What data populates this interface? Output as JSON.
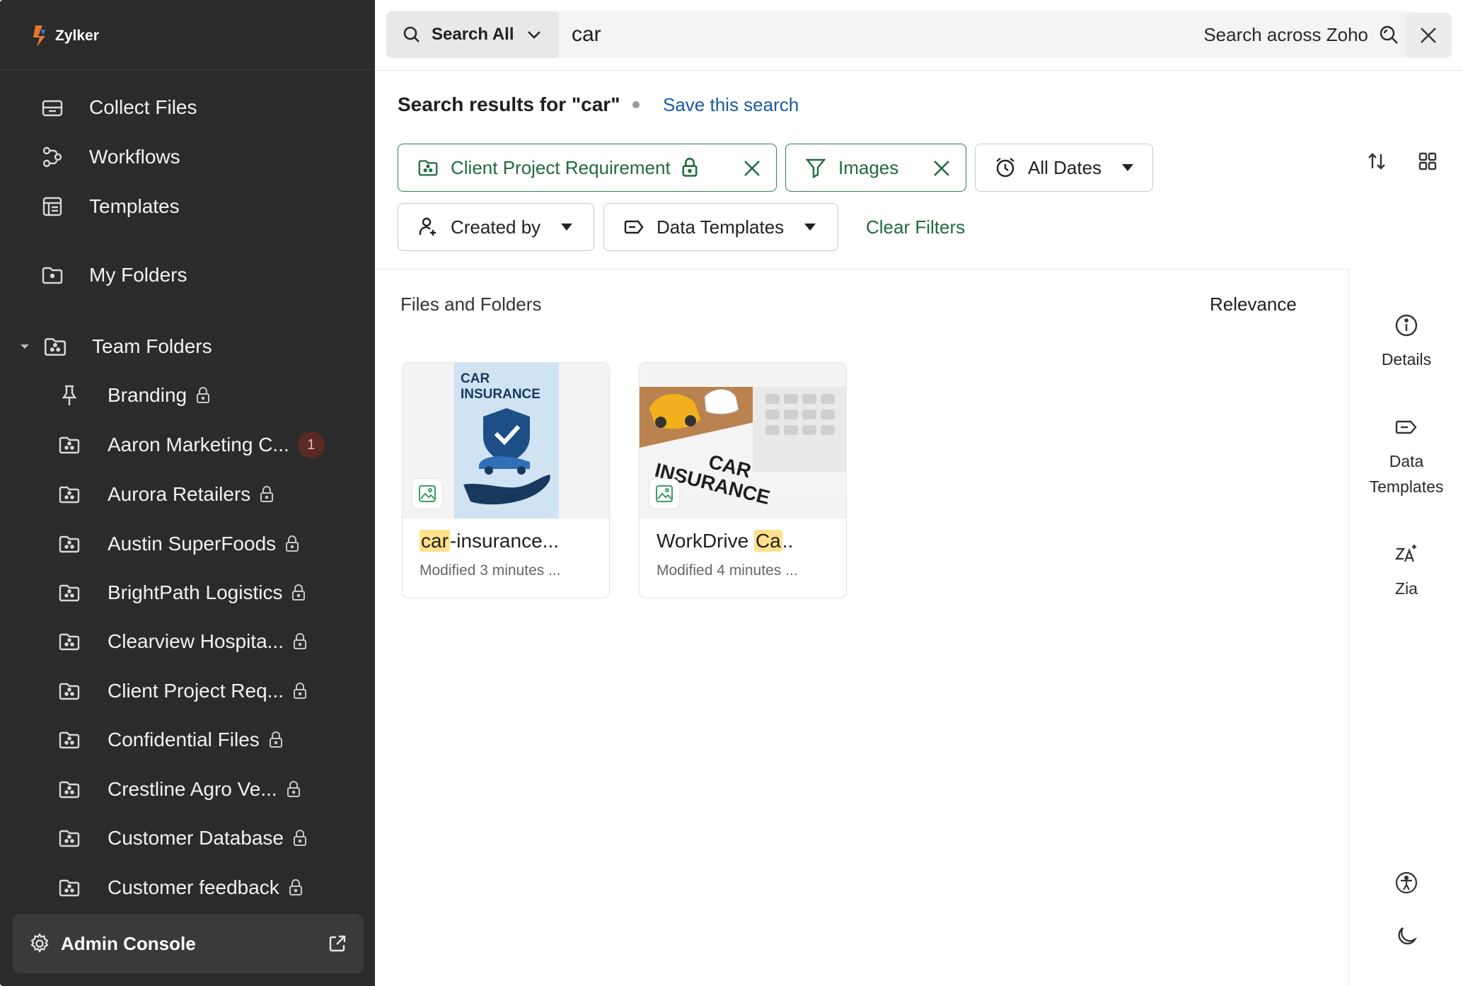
{
  "brand": {
    "name": "Zylker"
  },
  "sidebar": {
    "primary": [
      {
        "label": "Collect Files",
        "icon": "collect-files-icon"
      },
      {
        "label": "Workflows",
        "icon": "workflows-icon"
      },
      {
        "label": "Templates",
        "icon": "templates-icon"
      }
    ],
    "my_folders": {
      "label": "My Folders",
      "icon": "my-folders-icon"
    },
    "team_folders": {
      "label": "Team Folders",
      "items": [
        {
          "label": "Branding",
          "locked": true,
          "icon": "pin-icon"
        },
        {
          "label": "Aaron Marketing C...",
          "badge": "1",
          "icon": "team-folder-icon"
        },
        {
          "label": "Aurora Retailers",
          "locked": true,
          "icon": "team-folder-icon"
        },
        {
          "label": "Austin SuperFoods",
          "locked": true,
          "icon": "team-folder-icon"
        },
        {
          "label": "BrightPath Logistics",
          "locked": true,
          "icon": "team-folder-icon"
        },
        {
          "label": "Clearview Hospita...",
          "locked": true,
          "icon": "team-folder-icon"
        },
        {
          "label": "Client Project Req...",
          "locked": true,
          "icon": "team-folder-icon"
        },
        {
          "label": "Confidential Files",
          "locked": true,
          "icon": "team-folder-icon"
        },
        {
          "label": "Crestline Agro Ve...",
          "locked": true,
          "icon": "team-folder-icon"
        },
        {
          "label": "Customer Database",
          "locked": true,
          "icon": "team-folder-icon"
        },
        {
          "label": "Customer feedback",
          "locked": true,
          "icon": "team-folder-icon"
        }
      ]
    },
    "admin_console": {
      "label": "Admin Console"
    }
  },
  "search": {
    "scope": "Search All",
    "query": "car",
    "across_label": "Search across Zoho"
  },
  "results": {
    "title": "Search results for \"car\"",
    "save_link": "Save this search",
    "filters": {
      "folder": "Client Project Requirement",
      "type": "Images",
      "dates": "All Dates",
      "created_by": "Created by",
      "data_templates": "Data Templates",
      "clear": "Clear Filters"
    },
    "section_label": "Files and Folders",
    "sort_label": "Relevance",
    "files": [
      {
        "name_highlight": "car",
        "name_rest": "-insurance...",
        "meta": "Modified 3 minutes ...",
        "thumb_text": [
          "CAR",
          "INSURANCE"
        ]
      },
      {
        "name_prefix": "WorkDrive ",
        "name_highlight": "Ca",
        "name_rest": "..",
        "meta": "Modified 4 minutes ...",
        "thumb_text": [
          "CAR",
          "INSURANCE"
        ]
      }
    ]
  },
  "right_panel": {
    "details": "Details",
    "data_templates": [
      "Data",
      "Templates"
    ],
    "zia": "Zia"
  },
  "colors": {
    "sidebar_bg": "#2b2b2b",
    "accent_green": "#1f6b3e",
    "link_blue": "#1a5aa6",
    "highlight": "#ffe08a"
  }
}
